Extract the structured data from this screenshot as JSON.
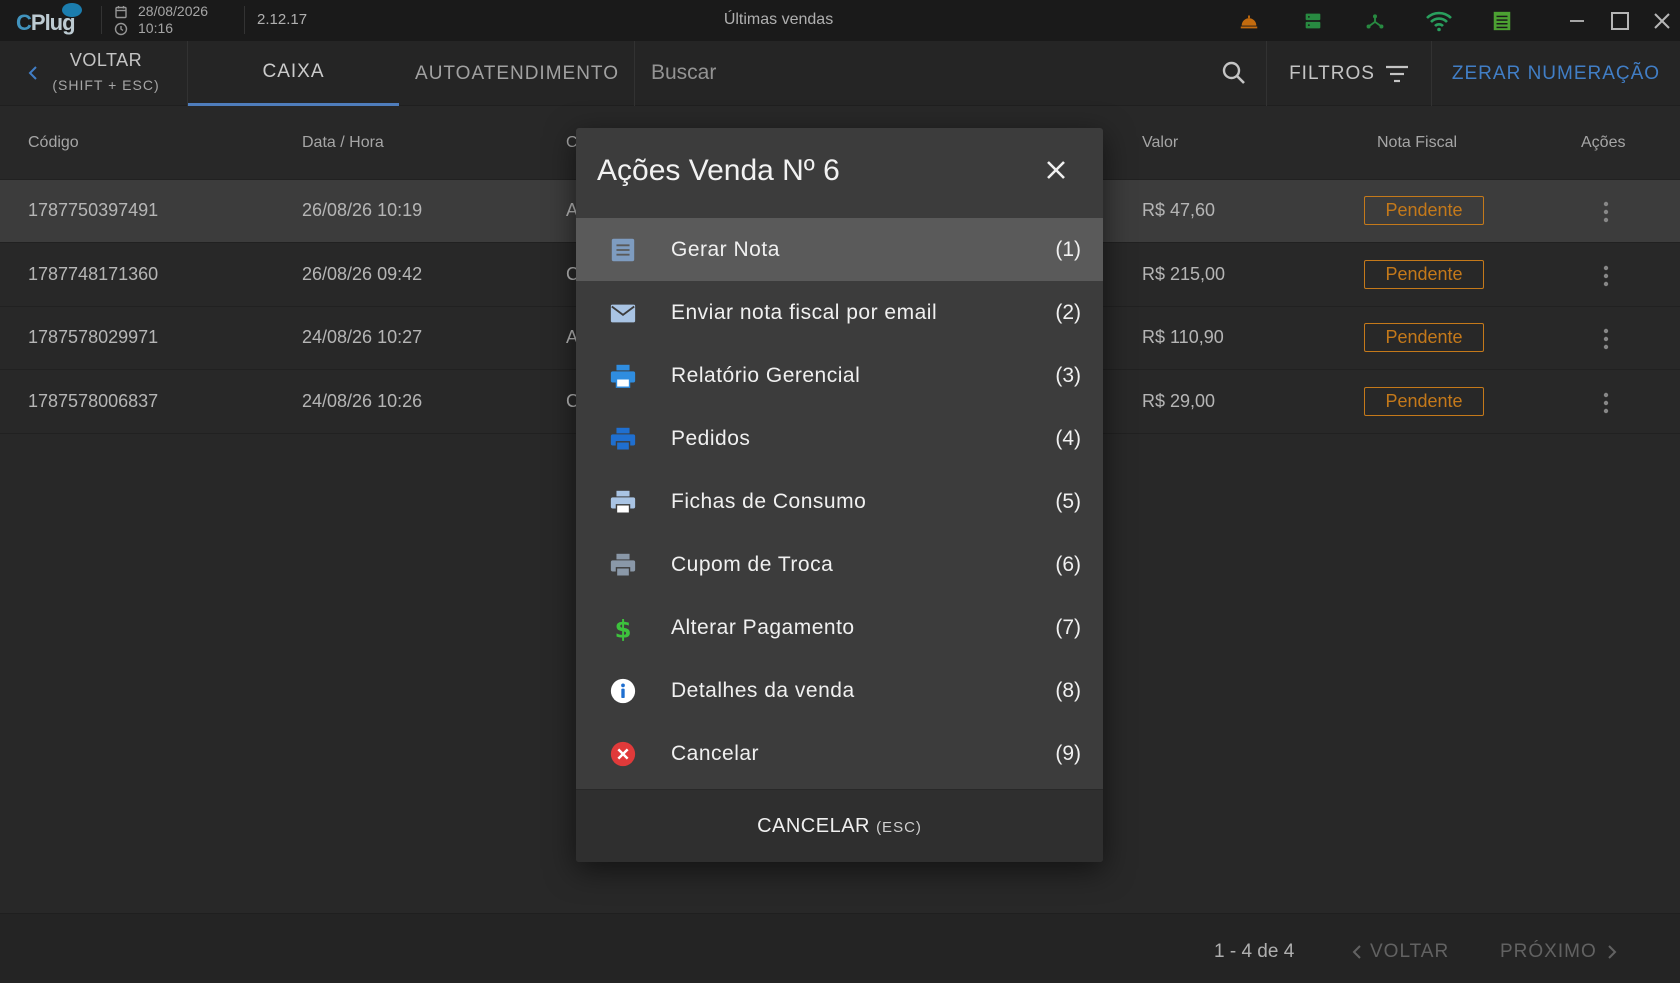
{
  "titlebar": {
    "brand": "Plug",
    "brand_initial": "C",
    "date": "28/08/2026",
    "time": "10:16",
    "version": "2.12.17",
    "title": "Últimas vendas"
  },
  "toolbar": {
    "back_label": "VOLTAR",
    "back_shortcut": "(SHIFT + ESC)",
    "tabs": [
      {
        "label": "CAIXA",
        "active": true
      },
      {
        "label": "AUTOATENDIMENTO",
        "active": false
      }
    ],
    "search_placeholder": "Buscar",
    "filters_label": "FILTROS",
    "zerar_label": "ZERAR NUMERAÇÃO"
  },
  "table": {
    "columns": [
      "Código",
      "Data / Hora",
      "C",
      "Valor",
      "Nota Fiscal",
      "Ações"
    ],
    "rows": [
      {
        "codigo": "1787750397491",
        "data": "26/08/26 10:19",
        "c": "A",
        "valor": "R$ 47,60",
        "nota": "Pendente"
      },
      {
        "codigo": "1787748171360",
        "data": "26/08/26 09:42",
        "c": "C",
        "valor": "R$ 215,00",
        "nota": "Pendente"
      },
      {
        "codigo": "1787578029971",
        "data": "24/08/26 10:27",
        "c": "A",
        "valor": "R$ 110,90",
        "nota": "Pendente"
      },
      {
        "codigo": "1787578006837",
        "data": "24/08/26 10:26",
        "c": "C",
        "valor": "R$ 29,00",
        "nota": "Pendente"
      }
    ]
  },
  "footer": {
    "count": "1 - 4 de 4",
    "prev_label": "VOLTAR",
    "next_label": "PRÓXIMO"
  },
  "dialog": {
    "title": "Ações Venda Nº 6",
    "items": [
      {
        "label": "Gerar Nota",
        "key": "(1)",
        "icon": "document-icon"
      },
      {
        "label": "Enviar nota fiscal por email",
        "key": "(2)",
        "icon": "email-icon"
      },
      {
        "label": "Relatório Gerencial",
        "key": "(3)",
        "icon": "printer-icon"
      },
      {
        "label": "Pedidos",
        "key": "(4)",
        "icon": "printer-icon"
      },
      {
        "label": "Fichas de Consumo",
        "key": "(5)",
        "icon": "printer-icon"
      },
      {
        "label": "Cupom de Troca",
        "key": "(6)",
        "icon": "printer-icon"
      },
      {
        "label": "Alterar Pagamento",
        "key": "(7)",
        "icon": "dollar-icon"
      },
      {
        "label": "Detalhes da venda",
        "key": "(8)",
        "icon": "info-icon"
      },
      {
        "label": "Cancelar",
        "key": "(9)",
        "icon": "cancel-icon"
      }
    ],
    "cancel_label": "CANCELAR",
    "cancel_shortcut": "(ESC)"
  },
  "colors": {
    "accent_blue": "#4a90e2",
    "pending_orange": "#e08a1e",
    "titlebar_bg": "#1e1e1e",
    "dialog_bg": "#3c3c3c"
  }
}
